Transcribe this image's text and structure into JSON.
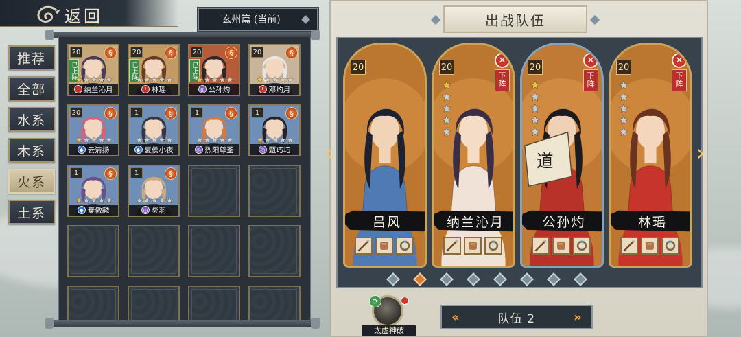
{
  "back": {
    "label": "返回"
  },
  "chapter": {
    "label": "玄州篇 (当前)"
  },
  "tabs": [
    {
      "label": "推荐",
      "active": true
    },
    {
      "label": "全部",
      "active": false
    },
    {
      "label": "水系",
      "active": false
    },
    {
      "label": "木系",
      "active": false
    },
    {
      "label": "火系",
      "active": false
    },
    {
      "label": "土系",
      "active": false
    }
  ],
  "roster": [
    {
      "name": "纳兰沁月",
      "level": "20",
      "stars": 1,
      "deployed": "已上阵",
      "faction": "red",
      "hair": "#4b3a5e",
      "bg": "#c6a878"
    },
    {
      "name": "林瑶",
      "level": "20",
      "stars": 0,
      "deployed": "已上阵",
      "faction": "red",
      "hair": "#6b3b2a",
      "bg": "#c29a62"
    },
    {
      "name": "公孙灼",
      "level": "20",
      "stars": 1,
      "deployed": "已上阵",
      "faction": "purple",
      "hair": "#2a2a2e",
      "bg": "#b85b3a"
    },
    {
      "name": "邓灼月",
      "level": "20",
      "stars": 1,
      "deployed": "",
      "faction": "red",
      "hair": "#e8e4e0",
      "bg": "#c8b49a"
    },
    {
      "name": "云清扬",
      "level": "20",
      "stars": 1,
      "deployed": "",
      "faction": "blue",
      "hair": "#d8607a",
      "bg": "#6f8fb6"
    },
    {
      "name": "夏侯小夜",
      "level": "1",
      "stars": 0,
      "deployed": "",
      "faction": "blue",
      "hair": "#3a3340",
      "bg": "#6f8fb6"
    },
    {
      "name": "烈阳尊圣",
      "level": "1",
      "stars": 0,
      "deployed": "",
      "faction": "purple",
      "hair": "#d87838",
      "bg": "#6f8fb6"
    },
    {
      "name": "甄巧巧",
      "level": "1",
      "stars": 1,
      "deployed": "",
      "faction": "purple",
      "hair": "#2a2024",
      "bg": "#6f8fb6"
    },
    {
      "name": "秦傲麟",
      "level": "1",
      "stars": 1,
      "deployed": "",
      "faction": "blue",
      "hair": "#6a4f8a",
      "bg": "#6f8fb6"
    },
    {
      "name": "炎羽",
      "level": "1",
      "stars": 0,
      "deployed": "",
      "faction": "purple",
      "hair": "#c9a882",
      "bg": "#6f8fb6"
    }
  ],
  "empty_slots": 10,
  "panel": {
    "title": "出战队伍"
  },
  "heroes": [
    {
      "name": "吕风",
      "level": "20",
      "stars": 0,
      "remove": false,
      "remove_label": "",
      "frame": "gold",
      "robe": "#4f7ab3",
      "hair": "#1e2230",
      "skin": "#f1d3b8",
      "stars_shown": false
    },
    {
      "name": "纳兰沁月",
      "level": "20",
      "stars": 1,
      "remove": true,
      "remove_label": "下阵",
      "frame": "gold",
      "robe": "#f0e2d6",
      "hair": "#3a2e46",
      "skin": "#f4dcc6",
      "stars_shown": true
    },
    {
      "name": "公孙灼",
      "level": "20",
      "stars": 1,
      "remove": true,
      "remove_label": "下阵",
      "frame": "blue",
      "robe": "#b8322a",
      "hair": "#1c1c20",
      "skin": "#f0d0b6",
      "stars_shown": true
    },
    {
      "name": "林瑶",
      "level": "20",
      "stars": 0,
      "remove": true,
      "remove_label": "下阵",
      "frame": "gold",
      "robe": "#c6342c",
      "hair": "#6a3420",
      "skin": "#f4d6bc",
      "stars_shown": true
    }
  ],
  "hero_fan_text": "道",
  "pages": {
    "count": 8,
    "active_index": 1
  },
  "team": {
    "label": "队伍 2"
  },
  "skill": {
    "label": "太虚神破"
  },
  "colors": {
    "accent": "#d97a2c",
    "remove_red": "#c8342a",
    "panel_dark": "#37424d"
  }
}
